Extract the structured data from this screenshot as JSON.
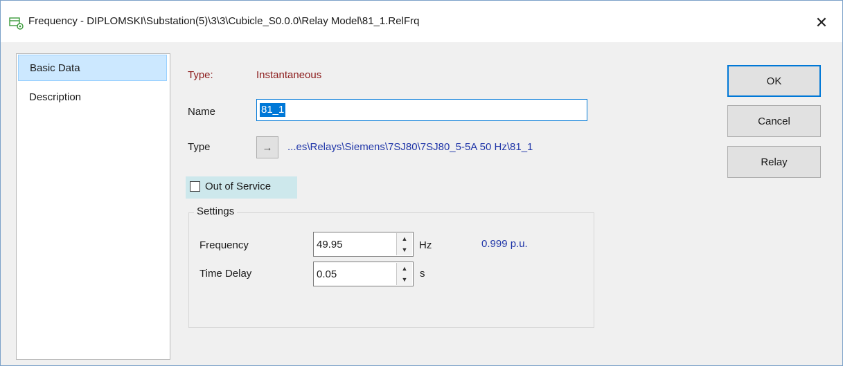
{
  "window": {
    "title": "Frequency - DIPLOMSKI\\Substation(5)\\3\\3\\Cubicle_S0.0.0\\Relay Model\\81_1.RelFrq",
    "close_icon": "close-icon",
    "title_icon": "relay-element-icon"
  },
  "nav": {
    "items": [
      {
        "label": "Basic Data",
        "selected": true
      },
      {
        "label": "Description",
        "selected": false
      }
    ]
  },
  "form": {
    "type_label": "Type:",
    "type_value": "Instantaneous",
    "name_label": "Name",
    "name_value": "81_1",
    "type_ref_label": "Type",
    "type_ref_icon": "arrow-right-icon",
    "type_ref_value": "...es\\Relays\\Siemens\\7SJ80\\7SJ80_5-5A 50 Hz\\81_1",
    "out_of_service_label": "Out of Service",
    "out_of_service_checked": false
  },
  "settings": {
    "title": "Settings",
    "frequency_label": "Frequency",
    "frequency_value": "49.95",
    "frequency_unit": "Hz",
    "frequency_pu": "0.999 p.u.",
    "time_delay_label": "Time Delay",
    "time_delay_value": "0.05",
    "time_delay_unit": "s"
  },
  "buttons": {
    "ok": "OK",
    "cancel": "Cancel",
    "relay": "Relay"
  },
  "colors": {
    "accent": "#0078d7",
    "maroon_text": "#8b1a1a",
    "link_blue": "#1f35a8",
    "selection_bg": "#cce8ff"
  }
}
